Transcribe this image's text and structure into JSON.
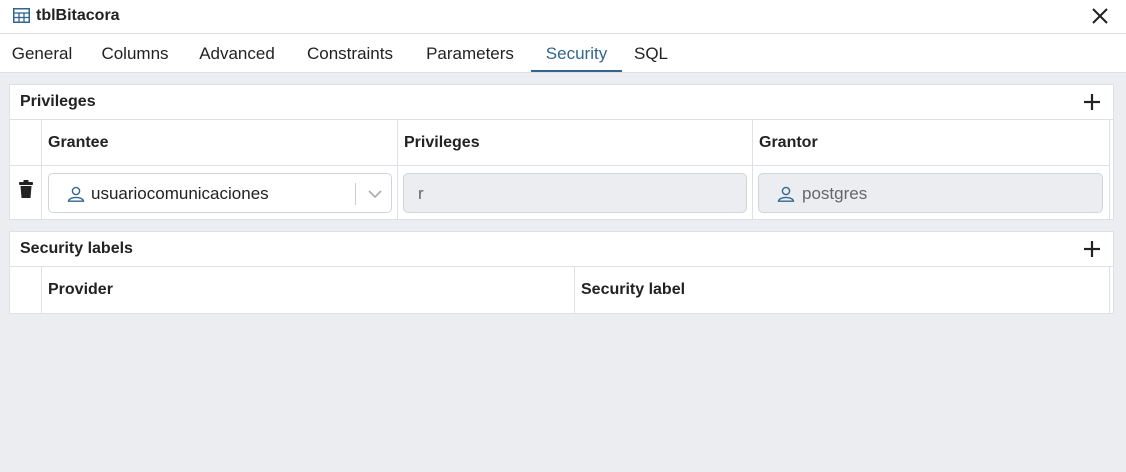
{
  "window": {
    "title": "tblBitacora",
    "title_icon": "table-icon",
    "close_icon": "close-icon"
  },
  "tabs": [
    {
      "label": "General"
    },
    {
      "label": "Columns"
    },
    {
      "label": "Advanced"
    },
    {
      "label": "Constraints"
    },
    {
      "label": "Parameters"
    },
    {
      "label": "Security",
      "active": true
    },
    {
      "label": "SQL"
    }
  ],
  "privileges": {
    "title": "Privileges",
    "add_icon": "plus-icon",
    "columns": [
      "Grantee",
      "Privileges",
      "Grantor"
    ],
    "rows": [
      {
        "grantee": "usuariocomunicaciones",
        "privileges": "r",
        "grantor": "postgres",
        "delete_icon": "trash-icon",
        "user_icon": "user-icon",
        "dropdown_icon": "chevron-down-icon"
      }
    ]
  },
  "security_labels": {
    "title": "Security labels",
    "add_icon": "plus-icon",
    "columns": [
      "Provider",
      "Security label"
    ]
  },
  "colors": {
    "accent": "#326690",
    "background": "#ebedf1",
    "panel": "#ffffff",
    "border": "#dde0e6",
    "readonly_field": "#ebedf1"
  }
}
